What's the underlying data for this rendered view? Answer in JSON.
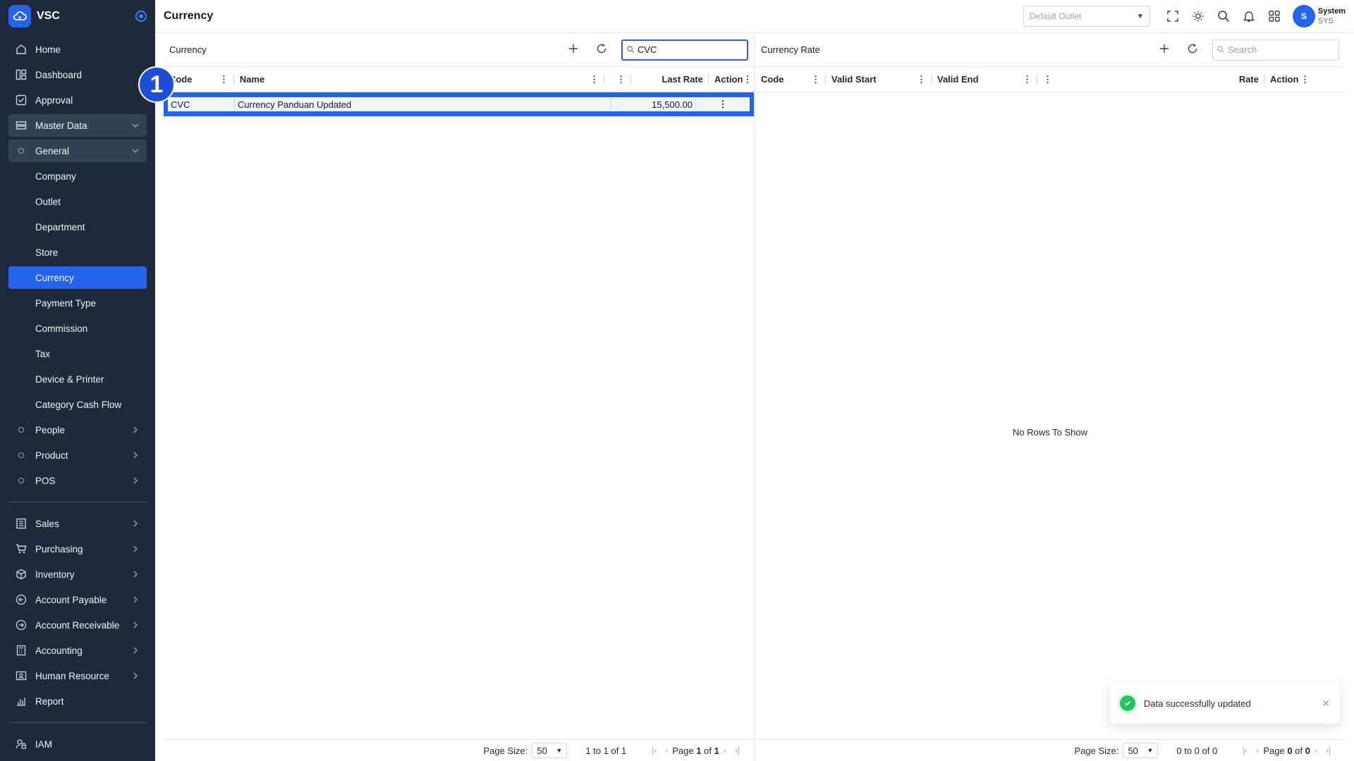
{
  "brand": {
    "name": "VSC"
  },
  "sidebar": {
    "items_top": [
      {
        "label": "Home",
        "icon": "home-icon"
      },
      {
        "label": "Dashboard",
        "icon": "dashboard-icon"
      },
      {
        "label": "Approval",
        "icon": "approval-icon"
      }
    ],
    "master_data": {
      "label": "Master Data"
    },
    "general": {
      "label": "General"
    },
    "general_items": [
      "Company",
      "Outlet",
      "Department",
      "Store",
      "Currency",
      "Payment Type",
      "Commission",
      "Tax",
      "Device & Printer",
      "Category Cash Flow"
    ],
    "active_item": "Currency",
    "groups": [
      "People",
      "Product",
      "POS"
    ],
    "modules": [
      {
        "label": "Sales",
        "icon": "sales-icon"
      },
      {
        "label": "Purchasing",
        "icon": "cart-icon"
      },
      {
        "label": "Inventory",
        "icon": "box-icon"
      },
      {
        "label": "Account Payable",
        "icon": "payable-icon"
      },
      {
        "label": "Account Receivable",
        "icon": "receivable-icon"
      },
      {
        "label": "Accounting",
        "icon": "calculator-icon"
      },
      {
        "label": "Human Resource",
        "icon": "id-card-icon"
      },
      {
        "label": "Report",
        "icon": "report-icon"
      }
    ],
    "bottom": [
      {
        "label": "IAM",
        "icon": "user-lock-icon"
      }
    ]
  },
  "header": {
    "title": "Currency",
    "outlet_placeholder": "Default Outlet",
    "user": {
      "initial": "S",
      "name": "System",
      "code": "SYS"
    }
  },
  "currency_panel": {
    "title": "Currency",
    "search_value": "CVC",
    "columns": [
      "Code",
      "Name",
      "Last Rate",
      "Action"
    ],
    "rows": [
      {
        "code": "CVC",
        "name": "Currency Panduan Updated",
        "last_rate": "15,500.00",
        "action": "⋮"
      }
    ],
    "pager": {
      "page_size_label": "Page Size:",
      "page_size": "50",
      "range": "1 to 1 of 1",
      "page_label": "Page",
      "page": "1",
      "of_label": "of",
      "total_pages": "1"
    }
  },
  "rate_panel": {
    "title": "Currency Rate",
    "search_placeholder": "Search",
    "columns": [
      "Code",
      "Valid Start",
      "Valid End",
      "Rate",
      "Action"
    ],
    "empty_message": "No Rows To Show",
    "pager": {
      "page_size_label": "Page Size:",
      "page_size": "50",
      "range": "0 to 0 of 0",
      "page_label": "Page",
      "page": "0",
      "of_label": "of",
      "total_pages": "0"
    }
  },
  "step_marker": "1",
  "toast": {
    "message": "Data successfully updated"
  },
  "colors": {
    "sidebar_bg": "#1e293b",
    "accent": "#2563eb",
    "success": "#22c55e"
  }
}
